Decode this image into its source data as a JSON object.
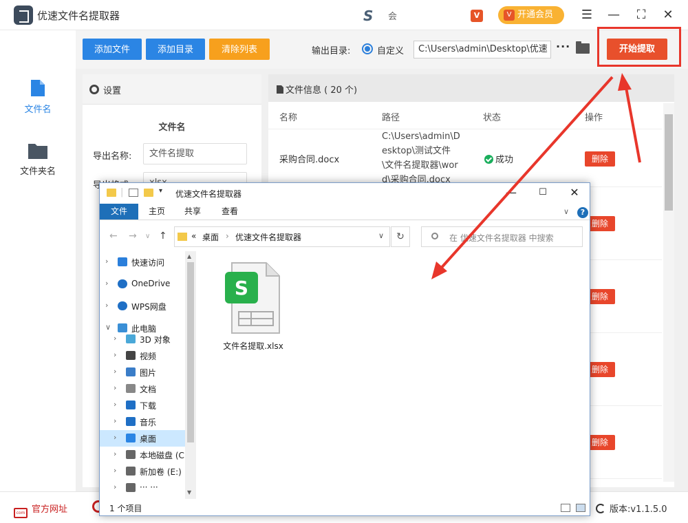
{
  "app": {
    "title": "优速文件名提取器",
    "user_name": "会",
    "vip_label": "开通会员",
    "vip_icon_glyph": "V"
  },
  "window_controls": {
    "menu": "☰",
    "minimize": "—",
    "maximize": "⛶",
    "close": "✕"
  },
  "nav": {
    "items": [
      {
        "label": "文件名",
        "active": true
      },
      {
        "label": "文件夹名",
        "active": false
      }
    ]
  },
  "toolbar": {
    "add_file": "添加文件",
    "add_dir": "添加目录",
    "clear_list": "清除列表",
    "output_label": "输出目录:",
    "custom_label": "自定义",
    "output_path": "C:\\Users\\admin\\Desktop\\优速",
    "more": "···",
    "start": "开始提取"
  },
  "colors": {
    "accent_blue": "#2b85e4",
    "clear_orange": "#f7a01d",
    "start_red": "#e8502c",
    "frame_red": "#e8362b",
    "success_green": "#1aae5c"
  },
  "settings": {
    "title": "设置",
    "section": "文件名",
    "export_name_label": "导出名称:",
    "export_name_value": "文件名提取",
    "export_format_label": "导出格式:",
    "export_format_value": "xlsx"
  },
  "fileinfo": {
    "title": "文件信息 ( 20 个)",
    "columns": {
      "name": "名称",
      "path": "路径",
      "status": "状态",
      "action": "操作"
    },
    "rows": [
      {
        "name": "采购合同.docx",
        "path": "C:\\Users\\admin\\Desktop\\测试文件\\文件名提取器\\word\\采购合同.docx",
        "status": "成功",
        "action": "删除"
      },
      {
        "action": "删除"
      },
      {
        "action": "删除"
      },
      {
        "action": "删除"
      },
      {
        "action": "删除"
      }
    ]
  },
  "statusbar": {
    "website": "官方网址",
    "version": "版本:v1.1.5.0"
  },
  "explorer": {
    "title": "优速文件名提取器",
    "ribbon": [
      "文件",
      "主页",
      "共享",
      "查看"
    ],
    "address": {
      "prefix": "«",
      "crumbs": [
        "桌面",
        "优速文件名提取器"
      ],
      "sep": "›"
    },
    "search_placeholder": "在 优速文件名提取器 中搜索",
    "tree": [
      {
        "label": "快速访问",
        "icon": "star-icon",
        "level": 0
      },
      {
        "label": "OneDrive",
        "icon": "cloud-icon",
        "level": 0
      },
      {
        "label": "WPS网盘",
        "icon": "cloud-icon",
        "level": 0
      },
      {
        "label": "此电脑",
        "icon": "pc-icon",
        "level": 0,
        "expanded": true
      },
      {
        "label": "3D 对象",
        "icon": "cube-icon",
        "level": 1
      },
      {
        "label": "视频",
        "icon": "video-icon",
        "level": 1
      },
      {
        "label": "图片",
        "icon": "picture-icon",
        "level": 1
      },
      {
        "label": "文档",
        "icon": "document-icon",
        "level": 1
      },
      {
        "label": "下载",
        "icon": "download-icon",
        "level": 1
      },
      {
        "label": "音乐",
        "icon": "music-icon",
        "level": 1
      },
      {
        "label": "桌面",
        "icon": "desktop-icon",
        "level": 1,
        "selected": true
      },
      {
        "label": "本地磁盘 (C:)",
        "icon": "drive-icon",
        "level": 1
      },
      {
        "label": "新加卷 (E:)",
        "icon": "drive-icon",
        "level": 1
      },
      {
        "label": "··· ···",
        "icon": "drive-icon",
        "level": 1
      }
    ],
    "file": {
      "name": "文件名提取.xlsx",
      "icon_letter": "S"
    },
    "item_count": "1 个项目"
  }
}
